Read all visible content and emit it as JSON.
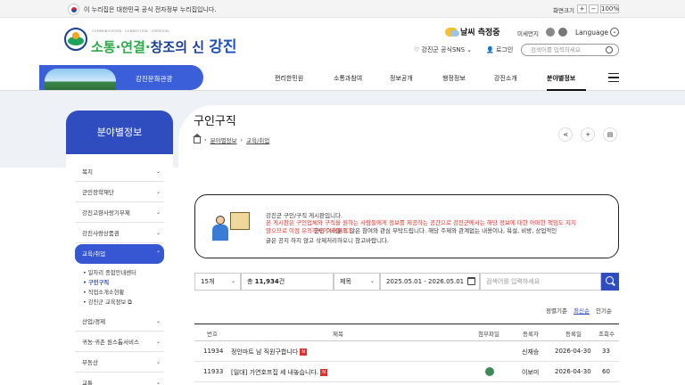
{
  "topbar": {
    "notice": "이 누리집은 대한민국 공식 전자정부 누리집입니다.",
    "zoom_label": "화면크기",
    "zoom_plus": "+",
    "zoom_minus": "−",
    "zoom_value": "100%"
  },
  "header": {
    "logo_sub": "COMMUNICATION · CONNECTION · CREATION",
    "logo_part1": "소통·연결·",
    "logo_part2": "창조의 신 ",
    "logo_part3": "강진",
    "weather": "날씨 측정중",
    "dust_label": "미세먼지",
    "language": "Language",
    "sns": "강진군 공식SNS",
    "login": "로그인",
    "search_placeholder": "검색어를 입력하세요"
  },
  "culture_banner": {
    "label": "강진문화관광"
  },
  "nav": [
    "편리한민원",
    "소통과참여",
    "정보공개",
    "행정정보",
    "강진소개",
    "분야별정보"
  ],
  "sidebar": {
    "title": "분야별정보",
    "items": [
      "복지",
      "군민장학재단",
      "강진고향사랑기부제",
      "강진사랑상품권",
      "교육/취업",
      "산업/경제",
      "귀농·귀촌 원스톱서비스",
      "부동산",
      "교통"
    ],
    "subitems": [
      "일자리 종합안내센터",
      "구인구직",
      "직업소개소현황",
      "강진군 교육정보"
    ]
  },
  "page": {
    "title": "구인구직",
    "breadcrumb": [
      "분야별정보",
      "교육/취업"
    ]
  },
  "notice": {
    "line1": "강진군 구인/구직 게시판입니다.",
    "line2": "본 게시판은 구인업체와 구직을 원하는 사람들에게 정보를 제공하는 공간으로 강진군에서는 해당 정보에 대한 어떠한 책임도 지지",
    "line3a": "않으므로 이점 유의하시기 바랍니다.",
    "line3b": "군민 여러분의 많은 참여와 관심 부탁드립니다. 해당 주제와 관계없는 내용이나, 욕설, 비방, 상업적인",
    "line4": "글은 공지 하지 않고 삭제처리하오니 참고바랍니다."
  },
  "filters": {
    "page_size": "15개",
    "total_label": "총 ",
    "total_count": "11,934",
    "total_suffix": "건",
    "field": "제목",
    "date_range": "2025.05.01 - 2026.05.01",
    "search_placeholder": "검색어를 입력하세요"
  },
  "sort": {
    "label": "정렬기준",
    "options": [
      "최신순",
      "인기순"
    ]
  },
  "table": {
    "columns": [
      "번호",
      "제목",
      "첨부파일",
      "등록자",
      "등록일",
      "조회수"
    ],
    "rows": [
      {
        "no": "11934",
        "title": "정인마트 남 직원구합니다",
        "new": "N",
        "author": "신재승",
        "date": "2026-04-30",
        "views": "33"
      },
      {
        "no": "11933",
        "title": "[일대] 가연호프집 세 내놓습니다.",
        "new": "N",
        "author": "이보미",
        "date": "2026-04-30",
        "views": "60"
      }
    ]
  },
  "colors": {
    "primary": "#2f4dbf",
    "accent_red": "#e0322a",
    "band_bg": "#eef1f5"
  }
}
